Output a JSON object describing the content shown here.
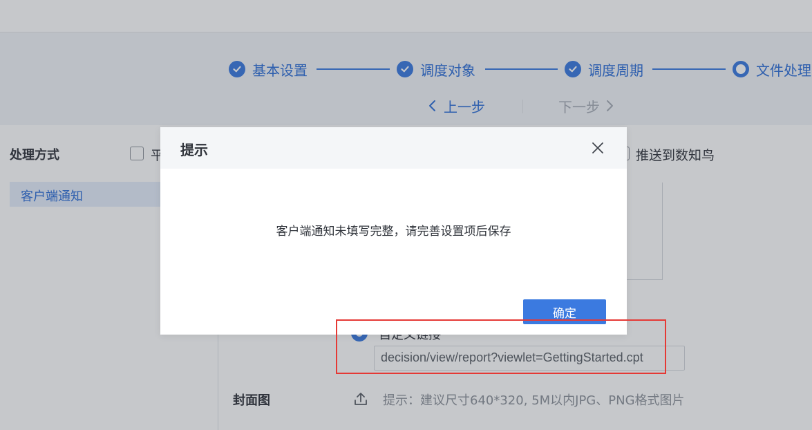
{
  "stepper": {
    "steps": [
      {
        "label": "基本设置",
        "status": "done",
        "icon": "check-circle-icon"
      },
      {
        "label": "调度对象",
        "status": "done",
        "icon": "check-circle-icon"
      },
      {
        "label": "调度周期",
        "status": "done",
        "icon": "check-circle-icon"
      },
      {
        "label": "文件处理",
        "status": "current",
        "icon": "radio-ring-icon"
      }
    ],
    "prev_label": "上一步",
    "next_label": "下一步"
  },
  "settings": {
    "method_label": "处理方式",
    "checkbox_platform": "平",
    "checkbox_push": "推送到数知鸟",
    "sidebar_item": "客户端通知",
    "radio_custom_link": "自定义链接",
    "url_value": "decision/view/report?viewlet=GettingStarted.cpt",
    "cover_label": "封面图",
    "cover_hint": "提示：建议尺寸640*320, 5M以内JPG、PNG格式图片"
  },
  "dialog": {
    "title": "提示",
    "message": "客户端通知未填写完整，请完善设置项后保存",
    "ok_label": "确定"
  },
  "colors": {
    "accent": "#3b7ae0",
    "mask": "rgba(45,52,62,0.27)",
    "highlight": "#e53935"
  }
}
